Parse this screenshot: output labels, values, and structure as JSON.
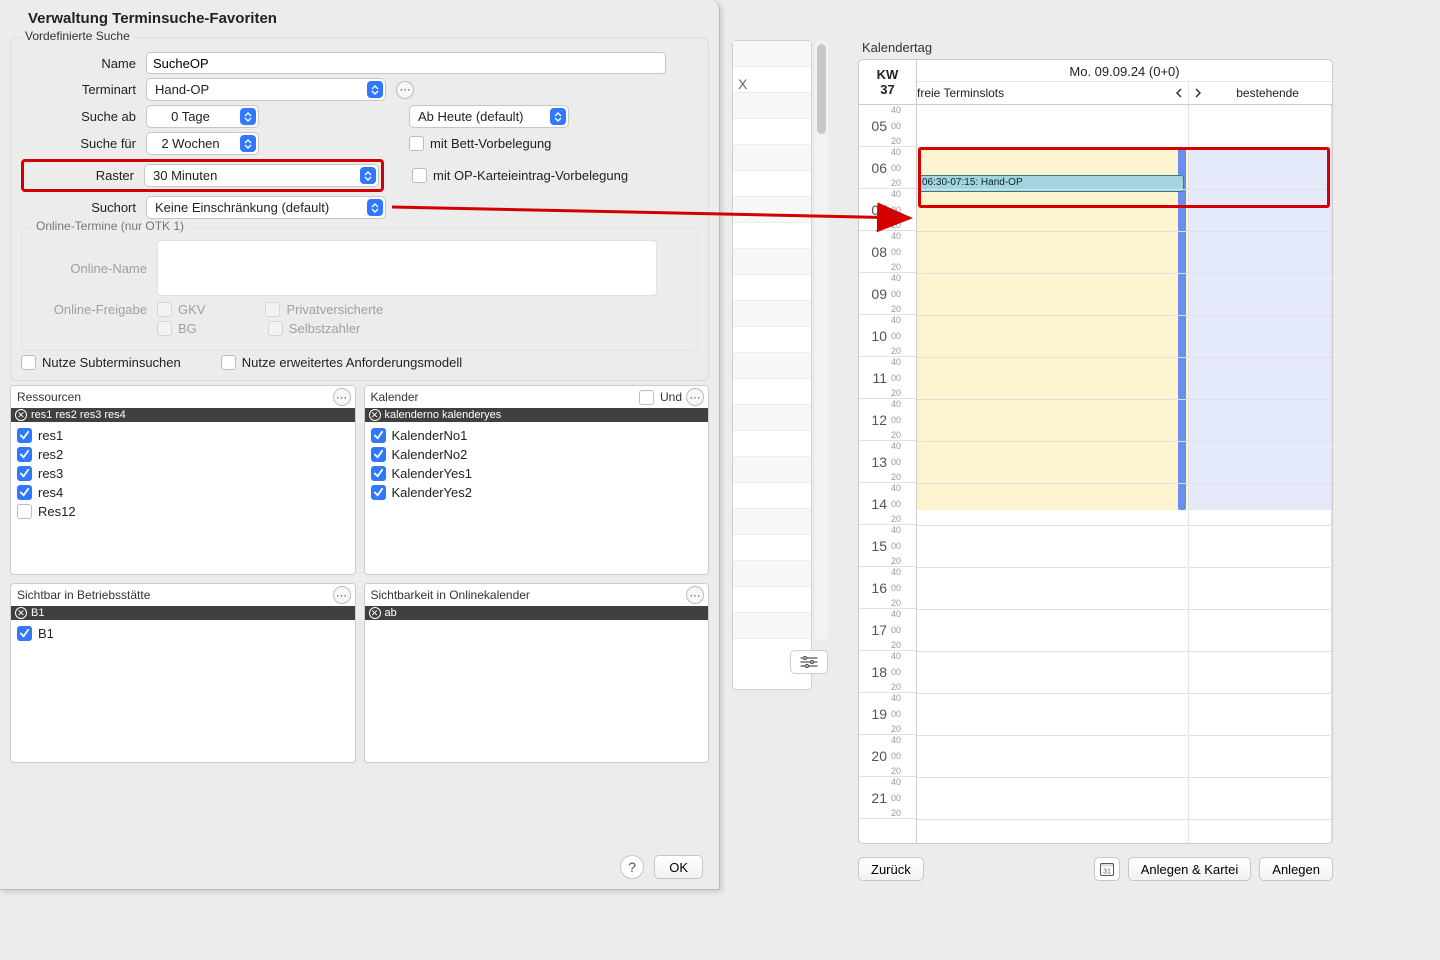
{
  "dialog": {
    "title": "Verwaltung Terminsuche-Favoriten",
    "fieldset_label": "Vordefinierte Suche",
    "labels": {
      "name": "Name",
      "terminart": "Terminart",
      "suche_ab": "Suche ab",
      "suche_fuer": "Suche für",
      "raster": "Raster",
      "suchort": "Suchort",
      "online_name": "Online-Name",
      "online_freigabe": "Online-Freigabe"
    },
    "values": {
      "name": "SucheOP",
      "terminart": "Hand-OP",
      "suche_ab": "0 Tage",
      "suche_ab_mode": "Ab Heute (default)",
      "suche_fuer": "2 Wochen",
      "raster": "30 Minuten",
      "suchort": "Keine Einschränkung (default)"
    },
    "checks": {
      "mit_bett": "mit Bett-Vorbelegung",
      "mit_op": "mit OP-Karteieintrag-Vorbelegung",
      "gkv": "GKV",
      "privat": "Privatversicherte",
      "bg": "BG",
      "selbst": "Selbstzahler",
      "sub": "Nutze Subterminsuchen",
      "erw": "Nutze erweitertes Anforderungsmodell"
    },
    "online_legend": "Online-Termine (nur OTK 1)",
    "lists": {
      "res_title": "Ressourcen",
      "res_tag": "res1 res2 res3 res4",
      "res_items": [
        {
          "label": "res1",
          "checked": true
        },
        {
          "label": "res2",
          "checked": true
        },
        {
          "label": "res3",
          "checked": true
        },
        {
          "label": "res4",
          "checked": true
        },
        {
          "label": "Res12",
          "checked": false
        }
      ],
      "kal_title": "Kalender",
      "kal_und": "Und",
      "kal_tag": "kalenderno kalenderyes",
      "kal_items": [
        {
          "label": "KalenderNo1",
          "checked": true
        },
        {
          "label": "KalenderNo2",
          "checked": true
        },
        {
          "label": "KalenderYes1",
          "checked": true
        },
        {
          "label": "KalenderYes2",
          "checked": true
        }
      ],
      "bs_title": "Sichtbar in Betriebsstätte",
      "bs_tag": "B1",
      "bs_items": [
        {
          "label": "B1",
          "checked": true
        }
      ],
      "ok_title": "Sichtbarkeit in Onlinekalender",
      "ok_tag": "ab",
      "ok_items": []
    },
    "footer": {
      "help": "?",
      "ok": "OK"
    }
  },
  "bg": {
    "x_label": "X"
  },
  "calendar": {
    "section_title": "Kalendertag",
    "kw_label": "KW",
    "kw_value": "37",
    "date": "Mo. 09.09.24 (0+0)",
    "col_free": "freie Terminslots",
    "col_exist": "bestehende",
    "event_text": "06:30-07:15: Hand-OP",
    "hours": [
      "05",
      "06",
      "07",
      "08",
      "09",
      "10",
      "11",
      "12",
      "13",
      "14",
      "15",
      "16",
      "17",
      "18",
      "19",
      "20",
      "21"
    ],
    "sub_labels": [
      "40",
      "00",
      "20"
    ]
  },
  "cal_footer": {
    "back": "Zurück",
    "create_card": "Anlegen & Kartei",
    "create": "Anlegen"
  }
}
